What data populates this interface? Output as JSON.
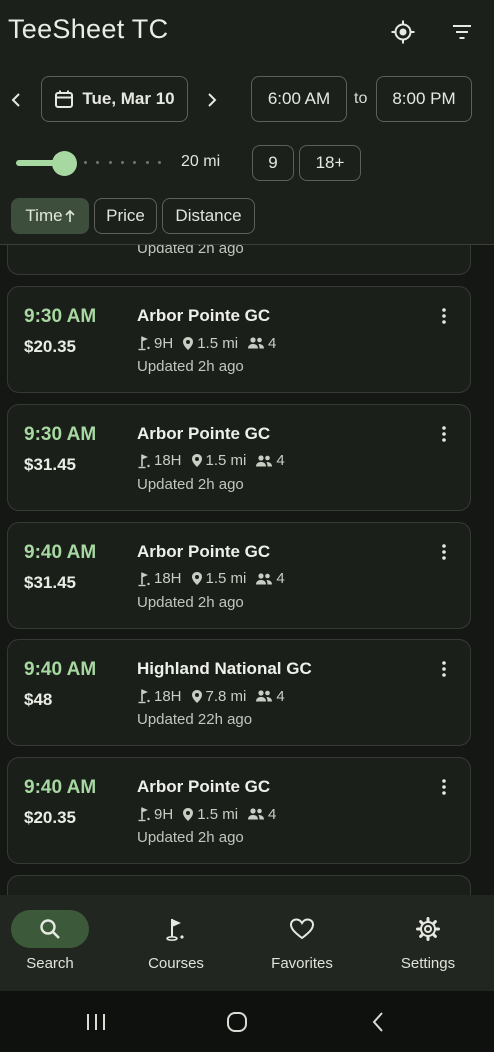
{
  "app": {
    "title": "TeeSheet TC"
  },
  "filters": {
    "date_label": "Tue, Mar 10",
    "start_time": "6:00 AM",
    "to_label": "to",
    "end_time": "8:00 PM",
    "distance": {
      "label": "20 mi",
      "value_fraction": 0.33
    },
    "holes_options": [
      "9",
      "18+"
    ],
    "sort_chips": [
      {
        "label": "Time",
        "selected": true,
        "direction_icon": "arrow-up-icon"
      },
      {
        "label": "Price",
        "selected": false
      },
      {
        "label": "Distance",
        "selected": false
      }
    ]
  },
  "partial_card": {
    "updated": "Updated 2h ago"
  },
  "tee_times": [
    {
      "time": "9:30 AM",
      "price": "$20.35",
      "course": "Arbor Pointe GC",
      "holes": "9H",
      "distance": "1.5 mi",
      "players": "4",
      "updated": "Updated 2h ago"
    },
    {
      "time": "9:30 AM",
      "price": "$31.45",
      "course": "Arbor Pointe GC",
      "holes": "18H",
      "distance": "1.5 mi",
      "players": "4",
      "updated": "Updated 2h ago"
    },
    {
      "time": "9:40 AM",
      "price": "$31.45",
      "course": "Arbor Pointe GC",
      "holes": "18H",
      "distance": "1.5 mi",
      "players": "4",
      "updated": "Updated 2h ago"
    },
    {
      "time": "9:40 AM",
      "price": "$48",
      "course": "Highland National GC",
      "holes": "18H",
      "distance": "7.8 mi",
      "players": "4",
      "updated": "Updated 22h ago"
    },
    {
      "time": "9:40 AM",
      "price": "$20.35",
      "course": "Arbor Pointe GC",
      "holes": "9H",
      "distance": "1.5 mi",
      "players": "4",
      "updated": "Updated 2h ago"
    }
  ],
  "bottom_nav": [
    {
      "label": "Search",
      "icon": "search-icon",
      "active": true
    },
    {
      "label": "Courses",
      "icon": "golf-flag-icon",
      "active": false
    },
    {
      "label": "Favorites",
      "icon": "heart-icon",
      "active": false
    },
    {
      "label": "Settings",
      "icon": "gear-icon",
      "active": false
    }
  ],
  "colors": {
    "accent": "#a7d8a1",
    "background": "#141713",
    "surface": "#1b1f1a"
  }
}
